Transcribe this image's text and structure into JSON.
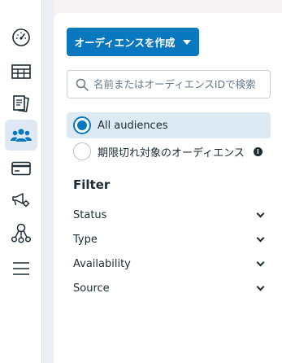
{
  "rail": {
    "items": [
      {
        "icon": "dashboard-gauge-icon"
      },
      {
        "icon": "table-grid-icon"
      },
      {
        "icon": "pages-stack-icon"
      },
      {
        "icon": "audience-people-icon",
        "active": true
      },
      {
        "icon": "credit-card-icon"
      },
      {
        "icon": "megaphone-settings-icon"
      },
      {
        "icon": "network-nodes-icon"
      },
      {
        "icon": "hamburger-menu-icon"
      }
    ]
  },
  "toolbar": {
    "create_label": "オーディエンスを作成"
  },
  "search": {
    "placeholder": "名前またはオーディエンスIDで検索"
  },
  "audience_filter": {
    "all_label": "All audiences",
    "expired_label": "期限切れ対象のオーディエンス"
  },
  "filter": {
    "title": "Filter",
    "rows": [
      "Status",
      "Type",
      "Availability",
      "Source"
    ]
  },
  "colors": {
    "accent": "#0a78be",
    "selected_bg": "#deeaf3",
    "text": "#1c2b33"
  }
}
